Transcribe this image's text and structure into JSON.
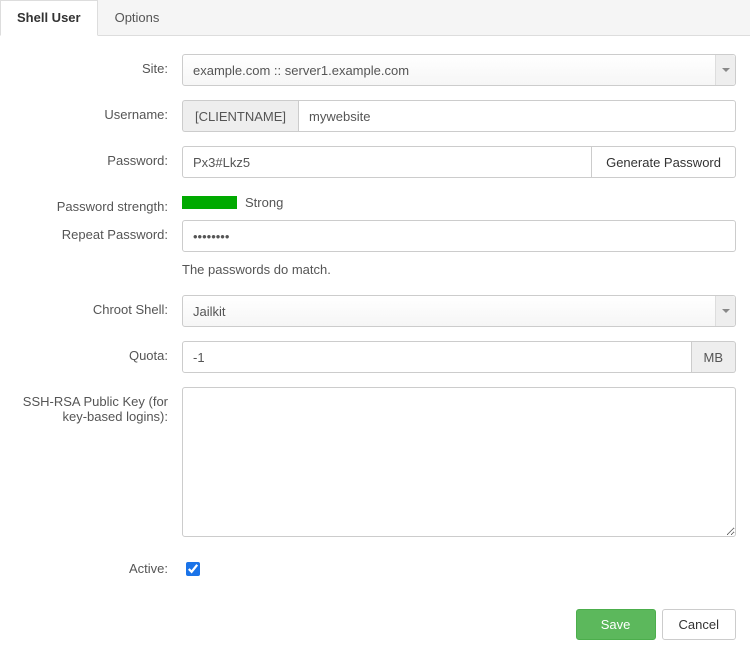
{
  "tabs": {
    "shell_user": "Shell User",
    "options": "Options"
  },
  "labels": {
    "site": "Site:",
    "username": "Username:",
    "password": "Password:",
    "password_strength": "Password strength:",
    "repeat_password": "Repeat Password:",
    "chroot_shell": "Chroot Shell:",
    "quota": "Quota:",
    "ssh_key": "SSH-RSA Public Key (for key-based logins):",
    "active": "Active:"
  },
  "values": {
    "site": "example.com :: server1.example.com",
    "username_prefix": "[CLIENTNAME]",
    "username": "mywebsite",
    "password": "Px3#Lkz5",
    "repeat_password": "••••••••",
    "chroot_shell": "Jailkit",
    "quota": "-1",
    "quota_unit": "MB",
    "ssh_key": "",
    "active": true
  },
  "strength": {
    "label": "Strong",
    "color": "#0a0"
  },
  "messages": {
    "passwords_match": "The passwords do match."
  },
  "buttons": {
    "generate_password": "Generate Password",
    "save": "Save",
    "cancel": "Cancel"
  }
}
